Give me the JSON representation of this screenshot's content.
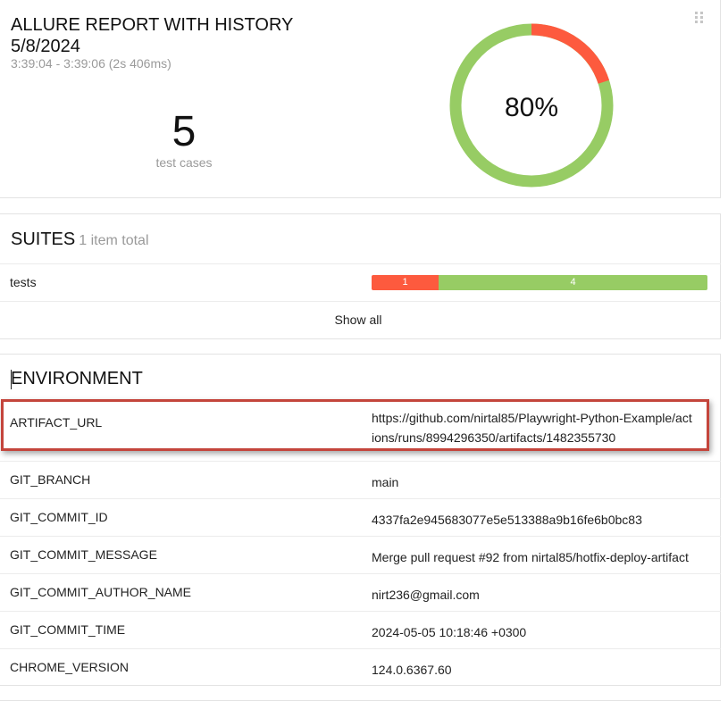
{
  "summary": {
    "title": "ALLURE REPORT WITH HISTORY",
    "date": "5/8/2024",
    "time_range": "3:39:04 - 3:39:06 (2s 406ms)",
    "test_cases_count": "5",
    "test_cases_label": "test cases",
    "pass_rate_label": "80%",
    "pass_fraction": 0.8,
    "fail_fraction": 0.2,
    "colors": {
      "passed": "#97cc64",
      "failed": "#fd5a3e"
    }
  },
  "suites": {
    "title": "SUITES",
    "count_label": "1 item total",
    "items": [
      {
        "name": "tests",
        "failed": "1",
        "passed": "4"
      }
    ],
    "show_all": "Show all"
  },
  "environment": {
    "title": "ENVIRONMENT",
    "rows": [
      {
        "key": "ARTIFACT_URL",
        "value": "https://github.com/nirtal85/Playwright-Python-Example/actions/runs/8994296350/artifacts/1482355730"
      },
      {
        "key": "GIT_BRANCH",
        "value": "main"
      },
      {
        "key": "GIT_COMMIT_ID",
        "value": "4337fa2e945683077e5e513388a9b16fe6b0bc83"
      },
      {
        "key": "GIT_COMMIT_MESSAGE",
        "value": "Merge pull request #92 from nirtal85/hotfix-deploy-artifact"
      },
      {
        "key": "GIT_COMMIT_AUTHOR_NAME",
        "value": "nirt236@gmail.com"
      },
      {
        "key": "GIT_COMMIT_TIME",
        "value": "2024-05-05 10:18:46 +0300"
      },
      {
        "key": "CHROME_VERSION",
        "value": "124.0.6367.60"
      }
    ],
    "highlight_color": "#c4453c"
  }
}
